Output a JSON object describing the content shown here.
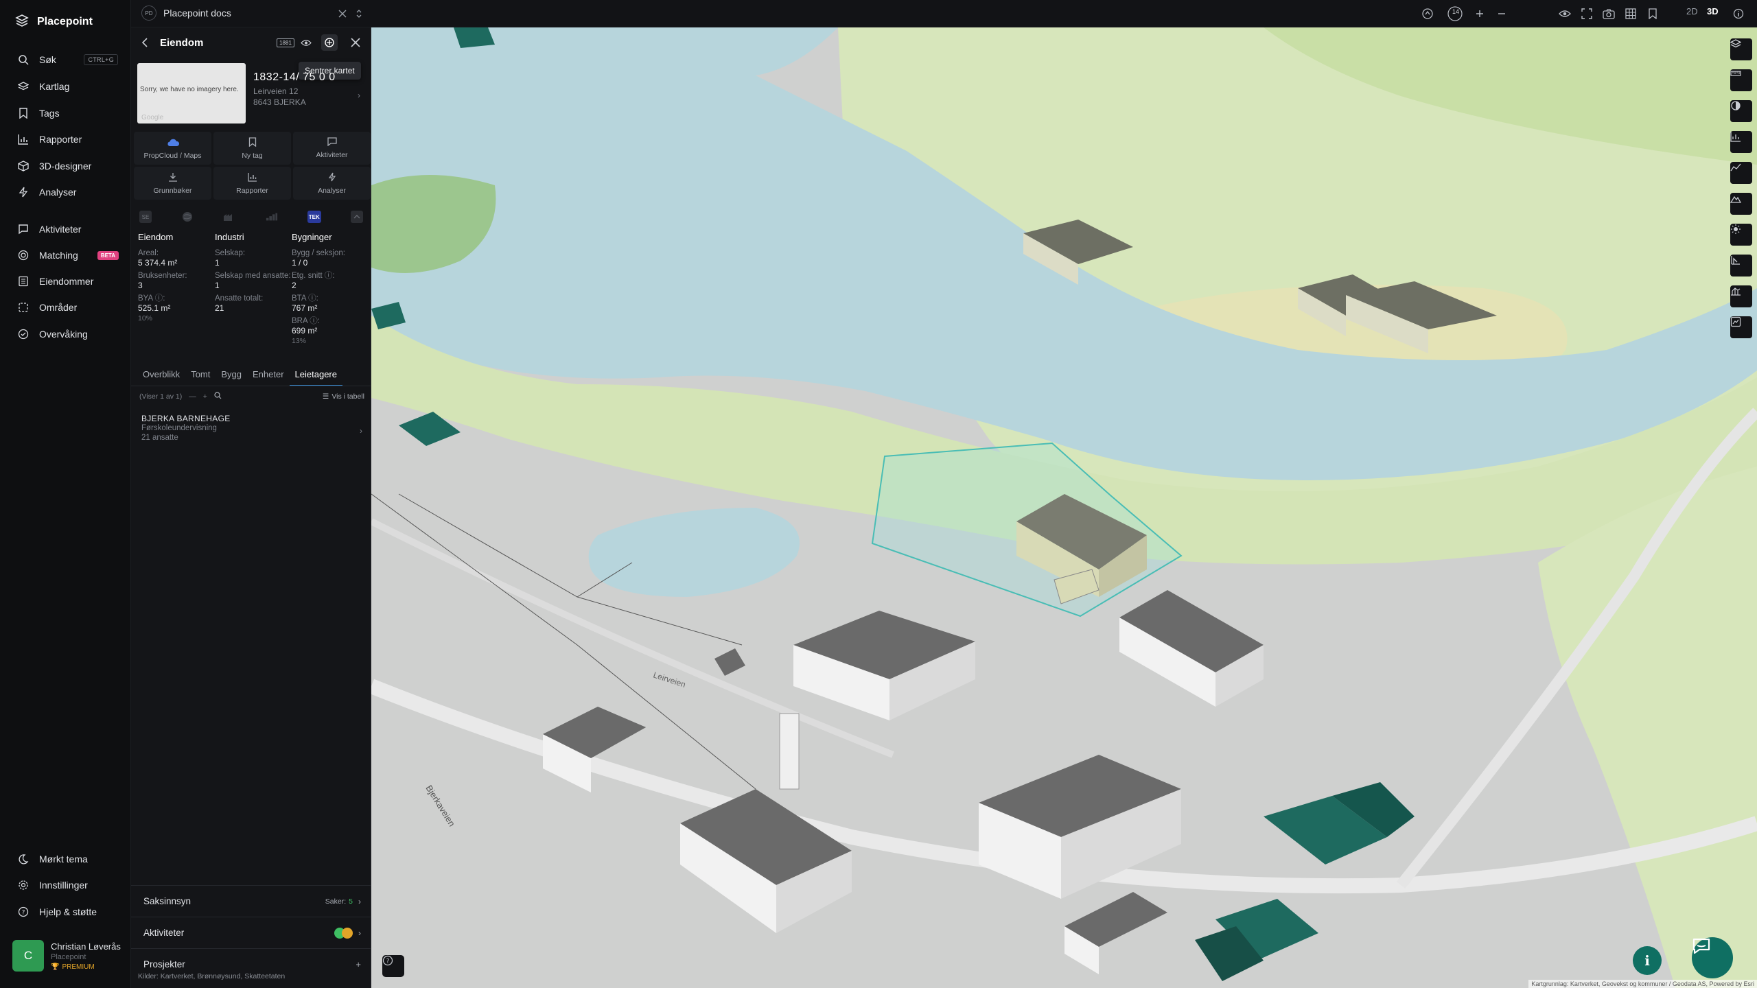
{
  "nav": {
    "brand": "Placepoint",
    "items": [
      {
        "label": "Søk",
        "kbd": "CTRL+G",
        "icon": "search-icon"
      },
      {
        "label": "Kartlag",
        "icon": "layers-icon"
      },
      {
        "label": "Tags",
        "icon": "bookmark-icon"
      },
      {
        "label": "Rapporter",
        "icon": "bar-chart-icon"
      },
      {
        "label": "3D-designer",
        "icon": "cube-icon"
      },
      {
        "label": "Analyser",
        "icon": "bolt-icon"
      },
      {
        "label": "Aktiviteter",
        "icon": "chat-icon"
      },
      {
        "label": "Matching",
        "badge": "BETA",
        "icon": "target-icon"
      },
      {
        "label": "Eiendommer",
        "icon": "building-icon"
      },
      {
        "label": "Områder",
        "icon": "area-icon"
      },
      {
        "label": "Overvåking",
        "icon": "watch-icon"
      }
    ],
    "bottom": [
      {
        "label": "Mørkt tema",
        "icon": "moon-icon"
      },
      {
        "label": "Innstillinger",
        "icon": "gear-icon"
      },
      {
        "label": "Hjelp & støtte",
        "icon": "help-icon"
      }
    ],
    "user": {
      "initial": "C",
      "name": "Christian Løverås",
      "org": "Placepoint",
      "plan": "PREMIUM"
    }
  },
  "topbar": {
    "workspace_badge": "PD",
    "workspace": "Placepoint docs",
    "zoom": "14",
    "view_2d": "2D",
    "view_3d": "3D",
    "active_view": "3D"
  },
  "panel": {
    "title": "Eiendom",
    "badge": "1881",
    "tooltip": "Sentrer kartet",
    "no_imagery": "Sorry, we have no imagery here.",
    "google": "Google",
    "gnr": "1832-14/ 75 0 0",
    "street": "Leirveien 12",
    "postal": "8643 BJERKA",
    "actions": [
      {
        "label": "PropCloud / Maps",
        "icon": "cloud-icon"
      },
      {
        "label": "Ny tag",
        "icon": "bookmark-icon"
      },
      {
        "label": "Aktiviteter",
        "icon": "chat-icon"
      },
      {
        "label": "Grunnbøker",
        "icon": "download-icon"
      },
      {
        "label": "Rapporter",
        "icon": "bar-chart-icon"
      },
      {
        "label": "Analyser",
        "icon": "bolt-icon"
      }
    ],
    "sources": [
      "SE",
      "TEK"
    ],
    "columns": {
      "eiendom": {
        "heading": "Eiendom",
        "areal_label": "Areal:",
        "areal_value": "5 374.4 m²",
        "bruk_label": "Bruksenheter:",
        "bruk_value": "3",
        "bya_label": "BYA ⓘ:",
        "bya_value": "525.1 m²",
        "bya_pct": "10%"
      },
      "industri": {
        "heading": "Industri",
        "selskap_label": "Selskap:",
        "selskap_value": "1",
        "ansatte_label": "Selskap med ansatte:",
        "ansatte_value": "1",
        "total_label": "Ansatte totalt:",
        "total_value": "21"
      },
      "bygninger": {
        "heading": "Bygninger",
        "bygg_label": "Bygg / seksjon:",
        "bygg_value": "1 / 0",
        "etg_label": "Etg. snitt ⓘ:",
        "etg_value": "2",
        "bta_label": "BTA ⓘ:",
        "bta_value": "767 m²",
        "bra_label": "BRA ⓘ:",
        "bra_value": "699 m²",
        "bra_pct": "13%"
      }
    },
    "tabs": [
      "Overblikk",
      "Tomt",
      "Bygg",
      "Enheter",
      "Leietagere"
    ],
    "active_tab": "Leietagere",
    "list_status": "(Viser 1 av 1)",
    "vis_i_tabell": "Vis i tabell",
    "tenant": {
      "name": "BJERKA BARNEHAGE",
      "sector": "Førskoleundervisning",
      "employees": "21 ansatte"
    },
    "sections": {
      "saksinnsyn": "Saksinnsyn",
      "saker_label": "Saker:",
      "saker_value": "5",
      "aktiviteter": "Aktiviteter",
      "prosjekter": "Prosjekter"
    },
    "credits_label": "Kilder:",
    "credits": [
      "Kartverket,",
      "Brønnøysund,",
      "Skatteetaten"
    ]
  },
  "map": {
    "road_label": "Bjerkaveien",
    "road_label_2": "Leirveien",
    "attribution": "Kartgrunnlag: Kartverket, Geovekst og kommuner / Geodata AS, Powered by Esri",
    "colors": {
      "water": "#b7d5dc",
      "grass": "#d6e6b9",
      "forest": "#99c58d",
      "ground": "#cfd0cf",
      "parcel": "#5ec6c0",
      "tree_building": "#1e6a5f"
    }
  }
}
